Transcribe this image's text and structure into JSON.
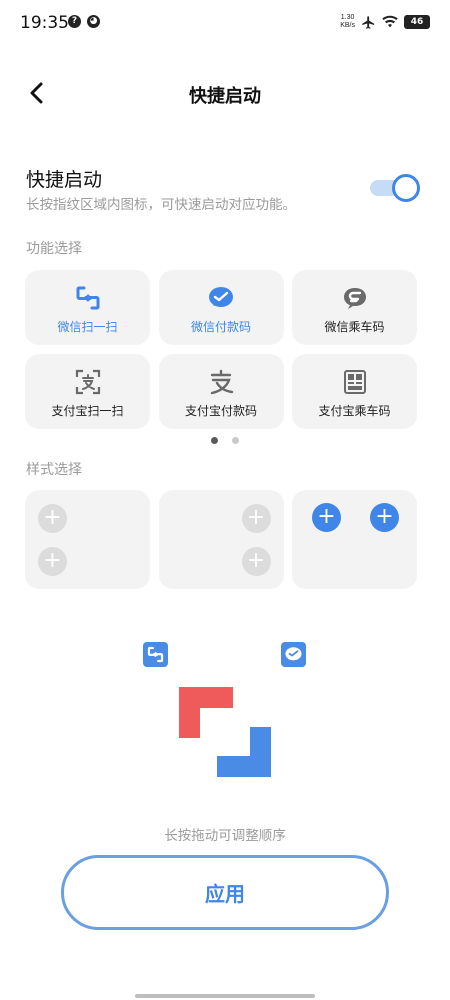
{
  "status_bar": {
    "time": "19:35",
    "net_speed_value": "1.30",
    "net_speed_unit": "KB/s",
    "battery": "46"
  },
  "header": {
    "title": "快捷启动"
  },
  "toggle": {
    "title": "快捷启动",
    "description": "长按指纹区域内图标，可快速启动对应功能。",
    "enabled": true
  },
  "function_section": {
    "label": "功能选择",
    "items": [
      {
        "label": "微信扫一扫",
        "icon": "wechat-scan-icon",
        "selected": true
      },
      {
        "label": "微信付款码",
        "icon": "wechat-pay-icon",
        "selected": true
      },
      {
        "label": "微信乘车码",
        "icon": "wechat-bus-code-icon",
        "selected": false
      },
      {
        "label": "支付宝扫一扫",
        "icon": "alipay-scan-icon",
        "selected": false
      },
      {
        "label": "支付宝付款码",
        "icon": "alipay-pay-icon",
        "selected": false
      },
      {
        "label": "支付宝乘车码",
        "icon": "alipay-bus-code-icon",
        "selected": false
      }
    ],
    "page": 1,
    "page_count": 2
  },
  "style_section": {
    "label": "样式选择"
  },
  "preview": {
    "hint": "长按拖动可调整顺序"
  },
  "apply_button": {
    "label": "应用"
  },
  "colors": {
    "accent": "#3f86e8",
    "bracket_red": "#ef5b5b",
    "bracket_blue": "#4a8be6"
  }
}
